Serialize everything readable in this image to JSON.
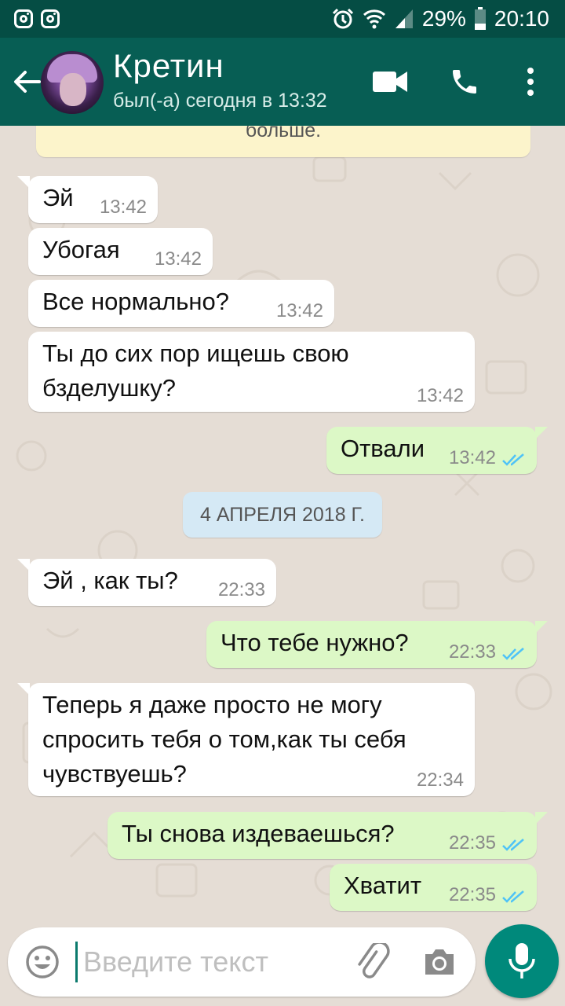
{
  "status_bar": {
    "battery": "29%",
    "time": "20:10",
    "icons": [
      "instagram-icon",
      "instagram-icon",
      "alarm-icon",
      "wifi-icon",
      "signal-icon",
      "battery-icon"
    ]
  },
  "header": {
    "contact_name": "Кретин",
    "last_seen": "был(-а) сегодня в 13:32",
    "icons": [
      "back-arrow-icon",
      "video-call-icon",
      "phone-icon",
      "more-vert-icon"
    ]
  },
  "banner": {
    "text": "больше."
  },
  "date_chip": "4 АПРЕЛЯ 2018 Г.",
  "messages": [
    {
      "dir": "in",
      "text": "Эй",
      "time": "13:42"
    },
    {
      "dir": "in",
      "text": "Убогая",
      "time": "13:42"
    },
    {
      "dir": "in",
      "text": "Все нормально?",
      "time": "13:42"
    },
    {
      "dir": "in",
      "text": "Ты до сих пор ищешь свою бзделушку?",
      "time": "13:42"
    },
    {
      "dir": "out",
      "text": "Отвали",
      "time": "13:42",
      "status": "read"
    },
    {
      "dir": "in",
      "text": "Эй , как ты?",
      "time": "22:33"
    },
    {
      "dir": "out",
      "text": "Что тебе нужно?",
      "time": "22:33",
      "status": "read"
    },
    {
      "dir": "in",
      "text": "Теперь я даже просто не могу спросить тебя о том,как ты себя чувствуешь?",
      "time": "22:34"
    },
    {
      "dir": "out",
      "text": "Ты снова издеваешься?",
      "time": "22:35",
      "status": "read"
    },
    {
      "dir": "out",
      "text": "Хватит",
      "time": "22:35",
      "status": "read"
    }
  ],
  "composer": {
    "placeholder": "Введите текст",
    "icons": [
      "emoji-icon",
      "attach-icon",
      "camera-icon",
      "mic-icon"
    ]
  },
  "colors": {
    "header": "#075e54",
    "status_bar": "#054d44",
    "outgoing_bubble": "#dcf8c6",
    "incoming_bubble": "#ffffff",
    "mic_button": "#00897b",
    "read_ticks": "#4fc3f7"
  }
}
